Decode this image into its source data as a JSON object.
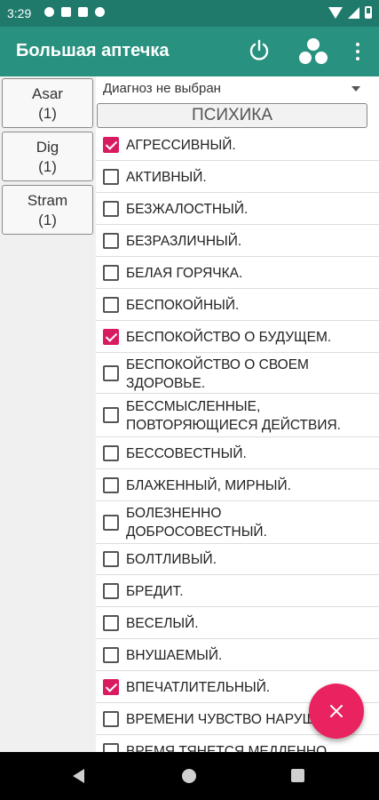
{
  "status_bar": {
    "time": "3:29",
    "left_icons": [
      "gear-icon",
      "shield-icon",
      "sd-card-icon",
      "app-icon"
    ],
    "right_icons": [
      "wifi-icon",
      "signal-icon",
      "battery-icon"
    ]
  },
  "app_bar": {
    "title": "Большая аптечка",
    "actions": [
      "power-icon",
      "three-dots-icon",
      "more-vert-icon"
    ]
  },
  "remedies": [
    {
      "name": "Asar",
      "count": "(1)"
    },
    {
      "name": "Dig",
      "count": "(1)"
    },
    {
      "name": "Stram",
      "count": "(1)"
    }
  ],
  "diagnosis": {
    "selected": "Диагноз не выбран"
  },
  "section": {
    "title": "ПСИХИКА"
  },
  "symptoms": [
    {
      "label": "АГРЕССИВНЫЙ.",
      "checked": true
    },
    {
      "label": "АКТИВНЫЙ.",
      "checked": false
    },
    {
      "label": "БЕЗЖАЛОСТНЫЙ.",
      "checked": false
    },
    {
      "label": "БЕЗРАЗЛИЧНЫЙ.",
      "checked": false
    },
    {
      "label": "БЕЛАЯ ГОРЯЧКА.",
      "checked": false
    },
    {
      "label": "БЕСПОКОЙНЫЙ.",
      "checked": false
    },
    {
      "label": "БЕСПОКОЙСТВО О БУДУЩЕМ.",
      "checked": true
    },
    {
      "label": "БЕСПОКОЙСТВО О СВОЕМ\nЗДОРОВЬЕ.",
      "checked": false
    },
    {
      "label": "БЕССМЫСЛЕННЫЕ,\nПОВТОРЯЮЩИЕСЯ ДЕЙСТВИЯ.",
      "checked": false
    },
    {
      "label": "БЕССОВЕСТНЫЙ.",
      "checked": false
    },
    {
      "label": "БЛАЖЕННЫЙ, МИРНЫЙ.",
      "checked": false
    },
    {
      "label": "БОЛЕЗНЕННО\nДОБРОСОВЕСТНЫЙ.",
      "checked": false
    },
    {
      "label": "БОЛТЛИВЫЙ.",
      "checked": false
    },
    {
      "label": "БРЕДИТ.",
      "checked": false
    },
    {
      "label": "ВЕСЕЛЫЙ.",
      "checked": false
    },
    {
      "label": "ВНУШАЕМЫЙ.",
      "checked": false
    },
    {
      "label": "ВПЕЧАТЛИТЕЛЬНЫЙ.",
      "checked": true
    },
    {
      "label": "ВРЕМЕНИ ЧУВСТВО НАРУШЕНО.",
      "checked": false
    },
    {
      "label": "ВРЕМЯ ТЯНЕТСЯ МЕДЛЕННО.",
      "checked": false
    }
  ],
  "fab": {
    "icon": "close-icon"
  },
  "nav_bar": {
    "buttons": [
      "back-icon",
      "home-icon",
      "recents-icon"
    ]
  },
  "colors": {
    "status_bar": "#1f7a6c",
    "app_bar": "#28917f",
    "accent": "#e8235f",
    "checkbox_checked": "#d81b60"
  }
}
